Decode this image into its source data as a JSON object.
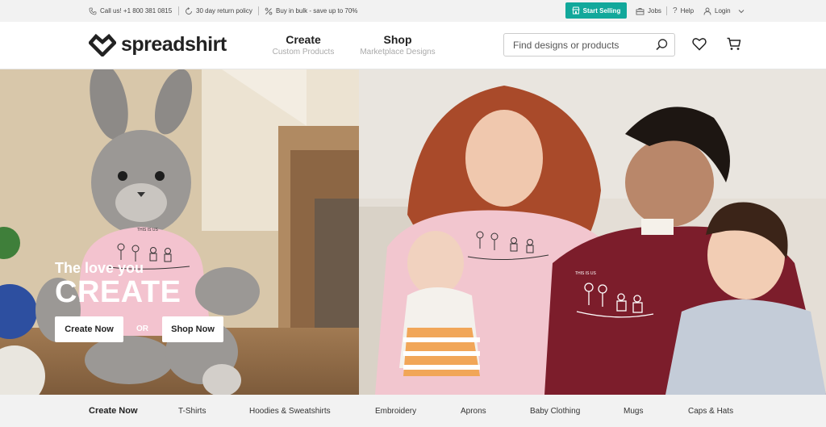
{
  "topbar": {
    "phone": "Call us! +1 800 381 0815",
    "returns": "30 day return policy",
    "bulk": "Buy in bulk - save up to 70%",
    "start_selling": "Start Selling",
    "jobs": "Jobs",
    "help": "Help",
    "login": "Login"
  },
  "header": {
    "logo": "spreadshirt",
    "nav": [
      {
        "title": "Create",
        "sub": "Custom Products"
      },
      {
        "title": "Shop",
        "sub": "Marketplace Designs"
      }
    ],
    "search_placeholder": "Find designs or products"
  },
  "hero": {
    "tagline": "The love you",
    "headline": "CREATE",
    "create_button": "Create Now",
    "or": "OR",
    "shop_button": "Shop Now",
    "shirt_print": "THIS IS US"
  },
  "categories": [
    "Create Now",
    "T-Shirts",
    "Hoodies & Sweatshirts",
    "Embroidery",
    "Aprons",
    "Baby Clothing",
    "Mugs",
    "Caps & Hats"
  ],
  "colors": {
    "accent": "#12a89b",
    "topbar_bg": "#f2f2f2",
    "hoodie_pink": "#f2c6cf",
    "hoodie_maroon": "#7c1d2b"
  },
  "icons": [
    "phone-icon",
    "return-icon",
    "percent-icon",
    "store-icon",
    "briefcase-icon",
    "question-icon",
    "user-icon",
    "chevron-down-icon",
    "heart-logo-icon",
    "search-icon",
    "heart-icon",
    "cart-icon"
  ]
}
